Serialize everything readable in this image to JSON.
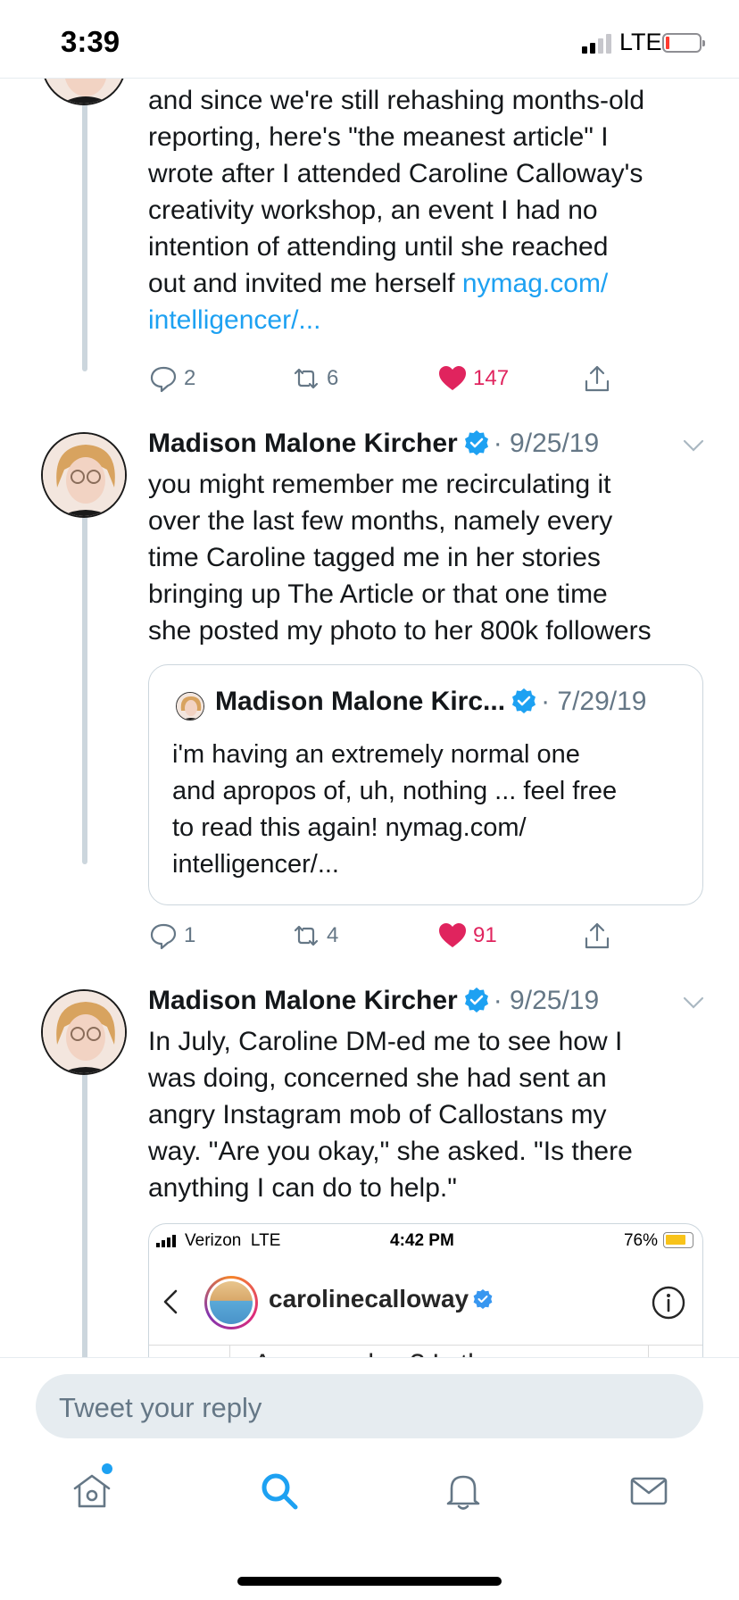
{
  "status_bar": {
    "time": "3:39",
    "network": "LTE",
    "battery_level_fraction": 0.1,
    "battery_color": "#ff3b30"
  },
  "tweets": [
    {
      "text_lines": [
        "and since we're still rehashing months-old",
        "reporting, here's \"the meanest article\" I",
        "wrote after I attended Caroline Calloway's",
        "creativity workshop, an event I had no",
        "intention of attending until she reached",
        "out and invited me herself "
      ],
      "link_part1": "nymag.com/",
      "link_part2": "intelligencer/...",
      "replies": "2",
      "retweets": "6",
      "likes": "147",
      "liked": true
    },
    {
      "author": "Madison Malone Kircher",
      "date": "· 9/25/19",
      "verified": true,
      "text_lines": [
        "you might remember me recirculating it",
        "over the last few months, namely every",
        "time Caroline tagged me in her stories",
        "bringing up The Article or that one time",
        "she posted my photo to her 800k followers"
      ],
      "quote": {
        "author": "Madison Malone Kirc...",
        "date": "· 7/29/19",
        "text_lines": [
          "i'm having an extremely normal one",
          "and apropos of, uh, nothing ... feel free",
          "to read this again! nymag.com/",
          "intelligencer/..."
        ]
      },
      "replies": "1",
      "retweets": "4",
      "likes": "91",
      "liked": true
    },
    {
      "author": "Madison Malone Kircher",
      "date": "· 9/25/19",
      "verified": true,
      "text_lines": [
        "In July, Caroline DM-ed me to see how I",
        "was doing, concerned she had sent an",
        "angry Instagram mob of Callostans my",
        "way. \"Are you okay,\" she asked. \"Is there",
        "anything I can do to help.\""
      ],
      "screenshot": {
        "carrier": "Verizon  LTE",
        "time": "4:42 PM",
        "battery": "76%",
        "battery_level_fraction": 0.76,
        "username": "carolinecalloway",
        "message_preview": "Are you okay? Is there"
      }
    }
  ],
  "reply_bar": {
    "placeholder": "Tweet your reply"
  },
  "tab_bar": {
    "items": [
      "home-icon",
      "search-icon",
      "notifications-icon",
      "messages-icon"
    ],
    "active": "search-icon",
    "home_has_notification": true
  },
  "colors": {
    "link": "#1da1f2",
    "like": "#e0245e",
    "muted": "#657786",
    "thread_line": "#ccd6dd"
  }
}
